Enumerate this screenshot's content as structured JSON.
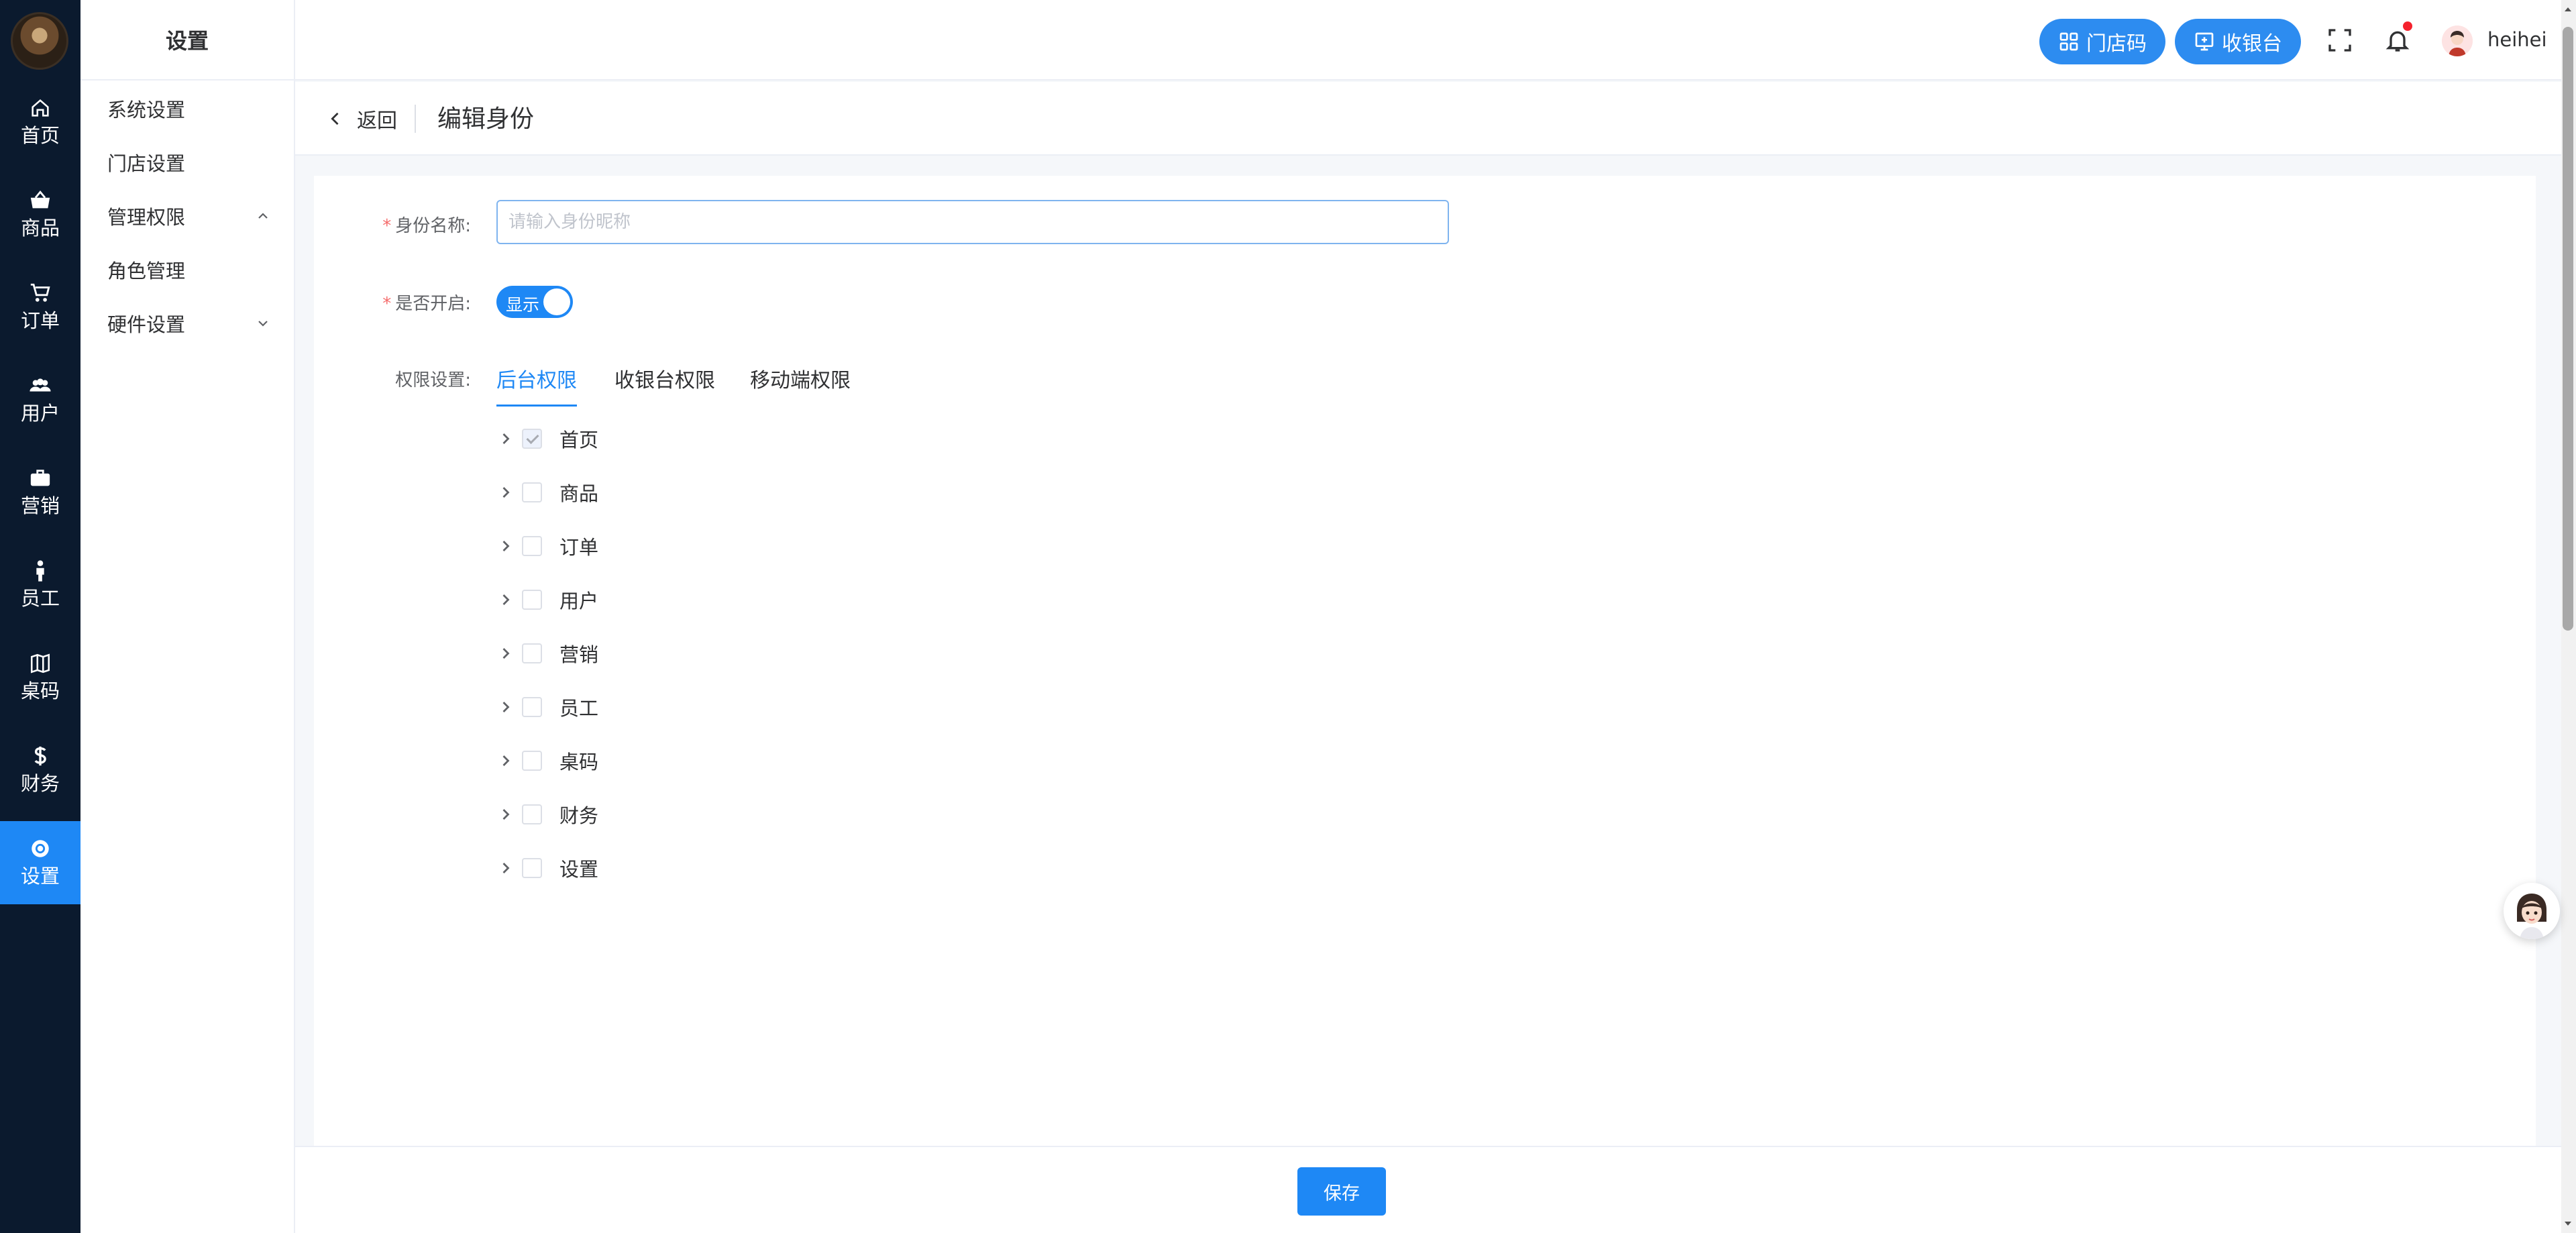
{
  "rail": {
    "items": [
      {
        "label": "首页",
        "icon": "home-icon"
      },
      {
        "label": "商品",
        "icon": "basket-icon"
      },
      {
        "label": "订单",
        "icon": "cart-icon"
      },
      {
        "label": "用户",
        "icon": "users-icon"
      },
      {
        "label": "营销",
        "icon": "briefcase-icon"
      },
      {
        "label": "员工",
        "icon": "person-icon"
      },
      {
        "label": "桌码",
        "icon": "map-icon"
      },
      {
        "label": "财务",
        "icon": "dollar-icon"
      },
      {
        "label": "设置",
        "icon": "gear-icon",
        "active": true
      }
    ]
  },
  "subnav": {
    "title": "设置",
    "items": [
      {
        "label": "系统设置"
      },
      {
        "label": "门店设置"
      },
      {
        "label": "管理权限",
        "expanded": true
      },
      {
        "label": "角色管理"
      },
      {
        "label": "硬件设置",
        "expanded": false
      }
    ]
  },
  "header": {
    "store_code_label": "门店码",
    "cashier_label": "收银台",
    "username": "heihei"
  },
  "pagebar": {
    "back_label": "返回",
    "title": "编辑身份"
  },
  "form": {
    "name_label": "身份名称:",
    "name_placeholder": "请输入身份昵称",
    "name_value": "",
    "enabled_label": "是否开启:",
    "enabled_text": "显示",
    "enabled": true,
    "perm_label": "权限设置:",
    "tabs": [
      {
        "label": "后台权限",
        "active": true
      },
      {
        "label": "收银台权限"
      },
      {
        "label": "移动端权限"
      }
    ],
    "tree": [
      {
        "label": "首页",
        "checked": true
      },
      {
        "label": "商品",
        "checked": false
      },
      {
        "label": "订单",
        "checked": false
      },
      {
        "label": "用户",
        "checked": false
      },
      {
        "label": "营销",
        "checked": false
      },
      {
        "label": "员工",
        "checked": false
      },
      {
        "label": "桌码",
        "checked": false
      },
      {
        "label": "财务",
        "checked": false
      },
      {
        "label": "设置",
        "checked": false
      }
    ]
  },
  "footer": {
    "save_label": "保存"
  },
  "colors": {
    "primary": "#1e88f5",
    "rail_bg": "#0b1a2e",
    "required": "#f56c6c"
  }
}
